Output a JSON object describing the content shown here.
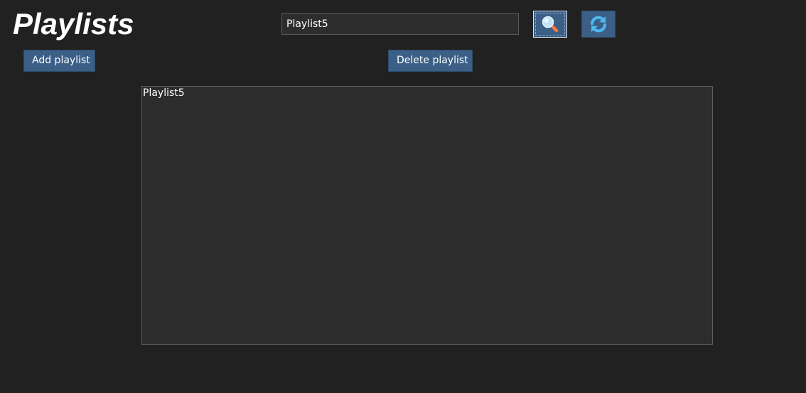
{
  "header": {
    "title": "Playlists"
  },
  "search": {
    "value": "Playlist5",
    "search_icon": "magnifier-icon",
    "refresh_icon": "refresh-icon"
  },
  "actions": {
    "add_label": "Add playlist",
    "delete_label": "Delete playlist"
  },
  "playlists": {
    "items": [
      {
        "name": "Playlist5"
      }
    ]
  },
  "colors": {
    "background": "#212121",
    "panel": "#2d2d2d",
    "button": "#3b5f86",
    "text": "#ffffff"
  }
}
